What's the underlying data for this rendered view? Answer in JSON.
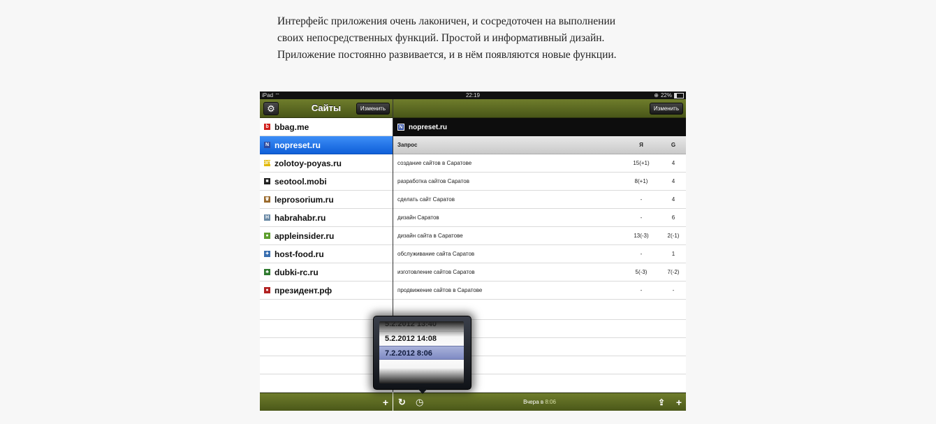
{
  "article": {
    "lines": [
      "Интерфейс приложения очень лаконичен, и сосредоточен на выполнении",
      "своих непосредственных функций. Простой и информативный дизайн.",
      "Приложение постоянно развивается, и в нём появляются новые функции."
    ]
  },
  "status_bar": {
    "device": "iPad",
    "time": "22:19",
    "battery": "22%"
  },
  "left_nav": {
    "title": "Сайты",
    "edit_label": "Изменить"
  },
  "right_nav": {
    "edit_label": "Изменить"
  },
  "sites": [
    {
      "name": "bbag.me",
      "icon": "bbag-favicon-icon",
      "color": "#d0201c",
      "glyph": "b"
    },
    {
      "name": "nopreset.ru",
      "icon": "nopreset-favicon-icon",
      "color": "#2c4aa0",
      "glyph": "N",
      "selected": true
    },
    {
      "name": "zolotoy-poyas.ru",
      "icon": "zolotoy-poyas-favicon-icon",
      "color": "#e2b800",
      "glyph": "ЗП"
    },
    {
      "name": "seotool.mobi",
      "icon": "seotool-favicon-icon",
      "color": "#222222",
      "glyph": "■"
    },
    {
      "name": "leprosorium.ru",
      "icon": "leprosorium-favicon-icon",
      "color": "#9a6a2c",
      "glyph": "♛"
    },
    {
      "name": "habrahabr.ru",
      "icon": "habrahabr-favicon-icon",
      "color": "#6a8aa6",
      "glyph": "H"
    },
    {
      "name": "appleinsider.ru",
      "icon": "appleinsider-favicon-icon",
      "color": "#5e9e2e",
      "glyph": "●"
    },
    {
      "name": "host-food.ru",
      "icon": "host-food-favicon-icon",
      "color": "#3a6fb0",
      "glyph": "✦"
    },
    {
      "name": "dubki-rc.ru",
      "icon": "dubki-rc-favicon-icon",
      "color": "#2f7a2f",
      "glyph": "♣"
    },
    {
      "name": "президент.рф",
      "icon": "president-favicon-icon",
      "color": "#b22222",
      "glyph": "●"
    }
  ],
  "selected_site": {
    "name": "nopreset.ru",
    "glyph": "N"
  },
  "table": {
    "headers": {
      "query": "Запрос",
      "yandex": "Я",
      "google": "G"
    },
    "rows": [
      {
        "query": "создание сайтов в Саратове",
        "yandex": "15(+1)",
        "google": "4"
      },
      {
        "query": "разработка сайтов Саратов",
        "yandex": "8(+1)",
        "google": "4"
      },
      {
        "query": "сделать сайт Саратов",
        "yandex": "-",
        "google": "4"
      },
      {
        "query": "дизайн Саратов",
        "yandex": "-",
        "google": "6"
      },
      {
        "query": "дизайн сайта в Саратове",
        "yandex": "13(-3)",
        "google": "2(-1)"
      },
      {
        "query": "обслуживание сайта Саратов",
        "yandex": "-",
        "google": "1"
      },
      {
        "query": "изготовление сайтов Саратов",
        "yandex": "5(-3)",
        "google": "7(-2)"
      },
      {
        "query": "продвижение сайтов в Саратове",
        "yandex": "-",
        "google": "-"
      }
    ]
  },
  "date_picker": {
    "partial_above": "5.2.2012 13:40",
    "items": [
      "5.2.2012 14:08",
      "7.2.2012 8:06"
    ],
    "selected": "7.2.2012 8:06"
  },
  "toolbar": {
    "add_glyph": "+",
    "refresh_glyph": "↻",
    "history_glyph": "◷",
    "share_glyph": "⇪",
    "status_prefix": "Вчера в",
    "status_time": "8:06"
  },
  "colors": {
    "bar_green": "#5d6b22",
    "selection_blue": "#1a6ae6",
    "picker_selection": "#8f99cf"
  }
}
